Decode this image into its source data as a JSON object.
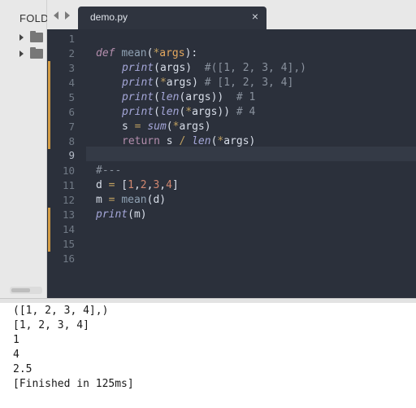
{
  "sidebar": {
    "title": "FOLD",
    "folders": [
      {
        "icon": "folder-icon"
      },
      {
        "icon": "folder-icon"
      }
    ]
  },
  "tabs": {
    "active_title": "demo.py",
    "close_glyph": "×"
  },
  "editor": {
    "line_numbers": [
      "1",
      "2",
      "3",
      "4",
      "5",
      "6",
      "7",
      "8",
      "9",
      "10",
      "11",
      "12",
      "13",
      "14",
      "15",
      "16"
    ],
    "current_line": "9",
    "code": {
      "l2": {
        "a": "def",
        "b": " ",
        "c": "mean",
        "d": "(",
        "e": "*",
        "f": "args",
        "g": "):"
      },
      "l3": {
        "a": "print",
        "b": "(args)  ",
        "c": "#([1, 2, 3, 4],)"
      },
      "l4": {
        "a": "print",
        "b": "(",
        "c": "*",
        "d": "args) ",
        "e": "# [1, 2, 3, 4]"
      },
      "l5": {
        "a": "print",
        "b": "(",
        "c": "len",
        "d": "(args))  ",
        "e": "# 1"
      },
      "l6": {
        "a": "print",
        "b": "(",
        "c": "len",
        "d": "(",
        "e": "*",
        "f": "args)) ",
        "g": "# 4"
      },
      "l7": {
        "a": "s ",
        "b": "=",
        "c": " ",
        "d": "sum",
        "e": "(",
        "f": "*",
        "g": "args)"
      },
      "l8": {
        "a": "return",
        "b": " s ",
        "c": "/",
        "d": " ",
        "e": "len",
        "f": "(",
        "g": "*",
        "h": "args)"
      },
      "l10": {
        "a": "#---"
      },
      "l11": {
        "a": "d ",
        "b": "=",
        "c": " [",
        "d": "1",
        "e": ",",
        "f": "2",
        "g": ",",
        "h": "3",
        "i": ",",
        "j": "4",
        "k": "]"
      },
      "l12": {
        "a": "m ",
        "b": "=",
        "c": " ",
        "d": "mean",
        "e": "(d)"
      },
      "l13": {
        "a": "print",
        "b": "(m)"
      }
    }
  },
  "console": {
    "lines": [
      "([1, 2, 3, 4],)",
      "[1, 2, 3, 4]",
      "1",
      "4",
      "2.5",
      "[Finished in 125ms]"
    ]
  },
  "colors": {
    "editor_bg": "#2b303b",
    "modified_marker": "#d29c45",
    "keyword": "#b48ead",
    "number": "#d08770"
  }
}
